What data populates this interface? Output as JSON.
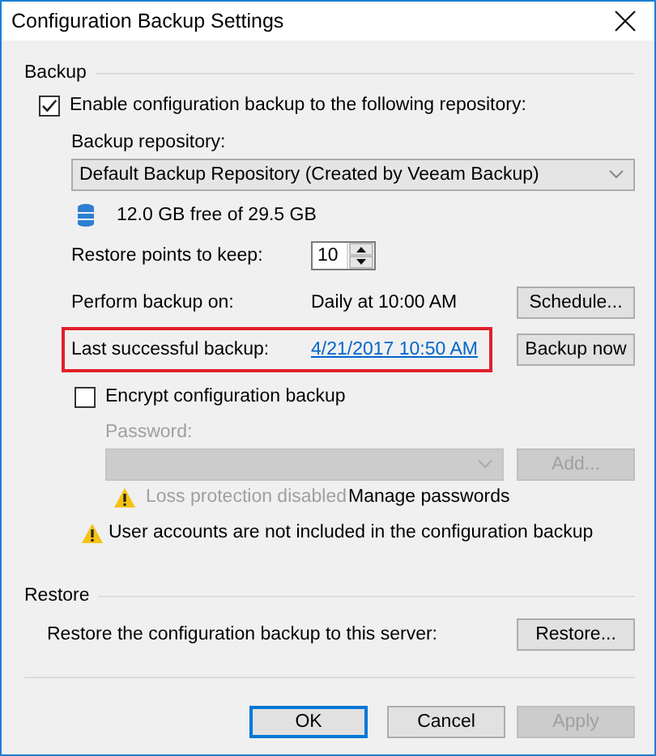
{
  "window": {
    "title": "Configuration Backup Settings"
  },
  "backup": {
    "label": "Backup",
    "enable": {
      "label": "Enable configuration backup to the following repository:",
      "checked": true
    },
    "repository": {
      "label": "Backup repository:",
      "value": "Default Backup Repository (Created by Veeam Backup)"
    },
    "storage": "12.0 GB free of 29.5 GB",
    "restore_points": {
      "label": "Restore points to keep:",
      "value": "10"
    },
    "schedule": {
      "label": "Perform backup on:",
      "value": "Daily at 10:00 AM",
      "button": "Schedule..."
    },
    "last_backup": {
      "label": "Last successful backup:",
      "value": "4/21/2017 10:50 AM",
      "button": "Backup now",
      "highlighted": true
    },
    "encrypt": {
      "label": "Encrypt configuration backup",
      "checked": false
    },
    "password": {
      "label": "Password:",
      "disabled": true,
      "button": "Add..."
    },
    "loss_protection": {
      "text": "Loss protection disabled",
      "disabled": true
    },
    "manage_passwords": "Manage passwords",
    "warning": "User accounts are not included in the configuration backup"
  },
  "restore": {
    "label": "Restore",
    "text": "Restore the configuration backup to this server:",
    "button": "Restore..."
  },
  "buttons": [
    {
      "label": "OK",
      "default": true,
      "disabled": false
    },
    {
      "label": "Cancel",
      "default": false,
      "disabled": false
    },
    {
      "label": "Apply",
      "default": false,
      "disabled": true
    }
  ]
}
